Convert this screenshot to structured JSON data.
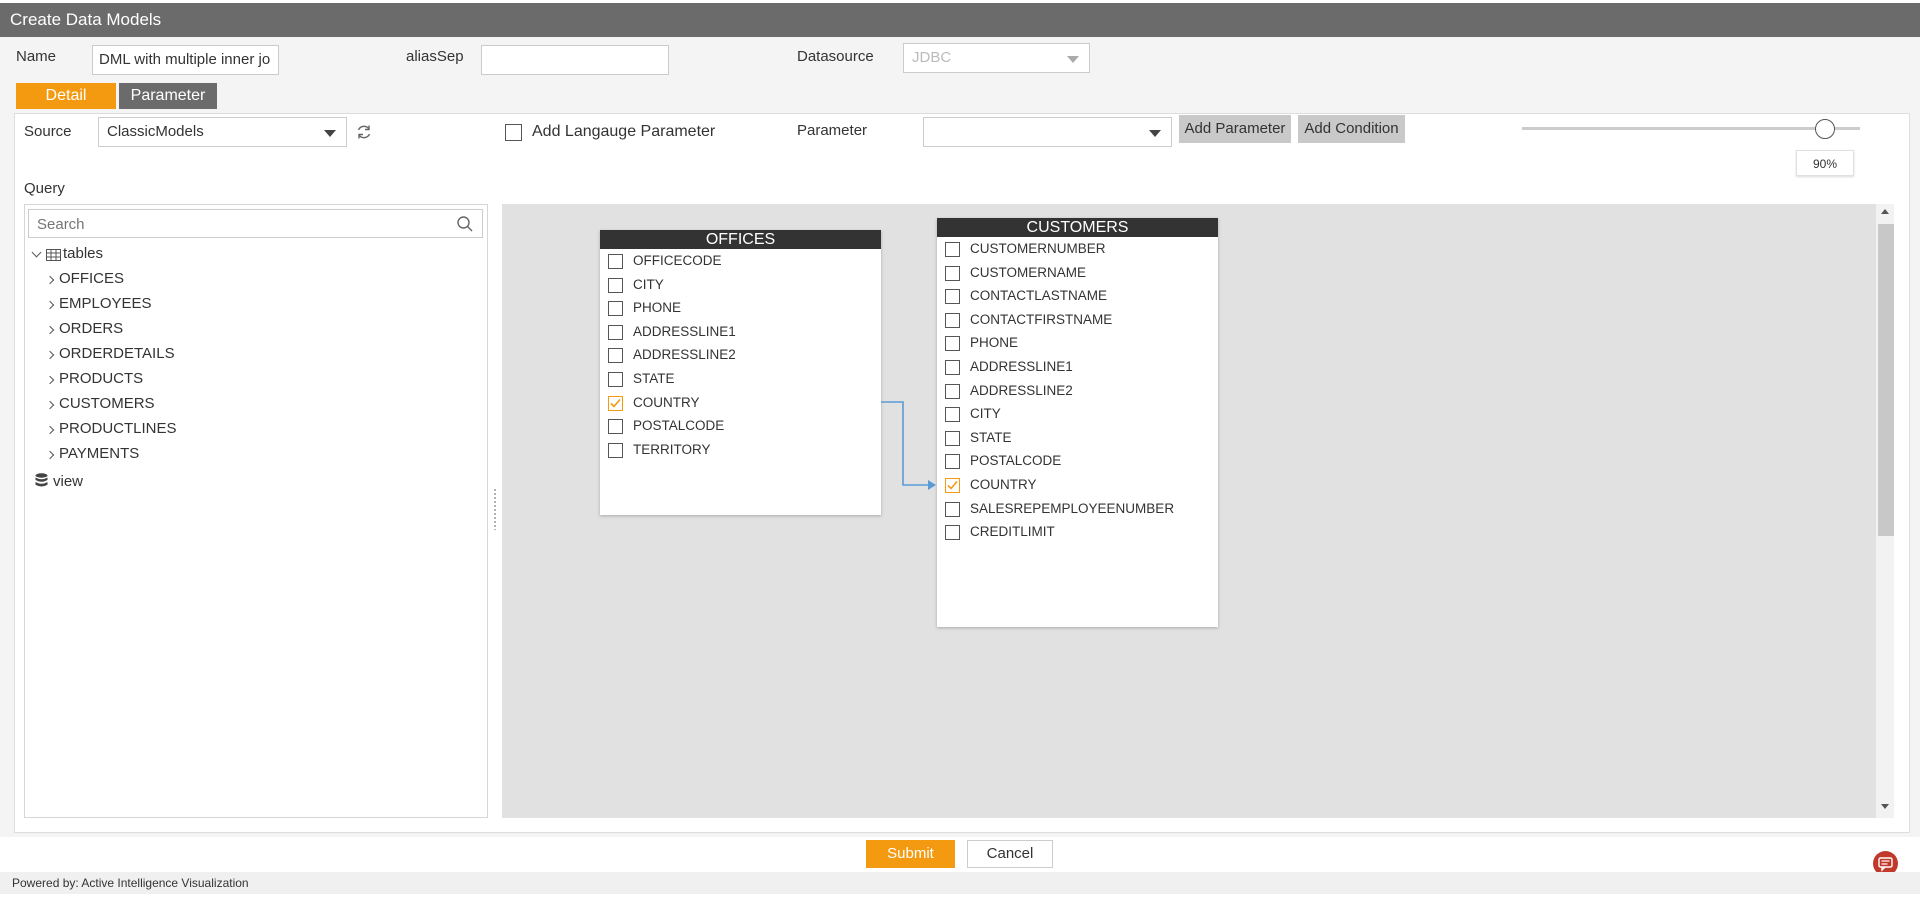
{
  "window": {
    "title": "Create Data Models"
  },
  "form": {
    "name_label": "Name",
    "name_value": "DML with multiple inner jo",
    "alias_label": "aliasSep",
    "alias_value": "",
    "datasource_label": "Datasource",
    "datasource_value": "JDBC"
  },
  "tabs": [
    {
      "label": "Detail",
      "active": true
    },
    {
      "label": "Parameter",
      "active": false
    }
  ],
  "detail": {
    "source_label": "Source",
    "source_value": "ClassicModels",
    "add_language_label": "Add Langauge Parameter",
    "add_language_checked": false,
    "parameter_label": "Parameter",
    "parameter_value": "",
    "add_parameter_button": "Add Parameter",
    "add_condition_button": "Add Condition",
    "zoom_label": "90%",
    "zoom_fraction": 0.9,
    "query_label": "Query"
  },
  "tree": {
    "search_placeholder": "Search",
    "tables_label": "tables",
    "tables": [
      "OFFICES",
      "EMPLOYEES",
      "ORDERS",
      "ORDERDETAILS",
      "PRODUCTS",
      "CUSTOMERS",
      "PRODUCTLINES",
      "PAYMENTS"
    ],
    "view_label": "view"
  },
  "diagram": {
    "tables": [
      {
        "name": "OFFICES",
        "fields": [
          {
            "name": "OFFICECODE",
            "checked": false
          },
          {
            "name": "CITY",
            "checked": false
          },
          {
            "name": "PHONE",
            "checked": false
          },
          {
            "name": "ADDRESSLINE1",
            "checked": false
          },
          {
            "name": "ADDRESSLINE2",
            "checked": false
          },
          {
            "name": "STATE",
            "checked": false
          },
          {
            "name": "COUNTRY",
            "checked": true
          },
          {
            "name": "POSTALCODE",
            "checked": false
          },
          {
            "name": "TERRITORY",
            "checked": false
          }
        ]
      },
      {
        "name": "CUSTOMERS",
        "fields": [
          {
            "name": "CUSTOMERNUMBER",
            "checked": false
          },
          {
            "name": "CUSTOMERNAME",
            "checked": false
          },
          {
            "name": "CONTACTLASTNAME",
            "checked": false
          },
          {
            "name": "CONTACTFIRSTNAME",
            "checked": false
          },
          {
            "name": "PHONE",
            "checked": false
          },
          {
            "name": "ADDRESSLINE1",
            "checked": false
          },
          {
            "name": "ADDRESSLINE2",
            "checked": false
          },
          {
            "name": "CITY",
            "checked": false
          },
          {
            "name": "STATE",
            "checked": false
          },
          {
            "name": "POSTALCODE",
            "checked": false
          },
          {
            "name": "COUNTRY",
            "checked": true
          },
          {
            "name": "SALESREPEMPLOYEENUMBER",
            "checked": false
          },
          {
            "name": "CREDITLIMIT",
            "checked": false
          }
        ]
      }
    ],
    "join": {
      "from": "OFFICES.COUNTRY",
      "to": "CUSTOMERS.COUNTRY"
    }
  },
  "actions": {
    "submit_label": "Submit",
    "cancel_label": "Cancel"
  },
  "footer": {
    "powered_by": "Powered by: Active Intelligence Visualization"
  },
  "colors": {
    "accent": "#f39a10",
    "titlebar": "#6b6b6b",
    "join_line": "#5b9bd5",
    "table_header": "#333333"
  }
}
